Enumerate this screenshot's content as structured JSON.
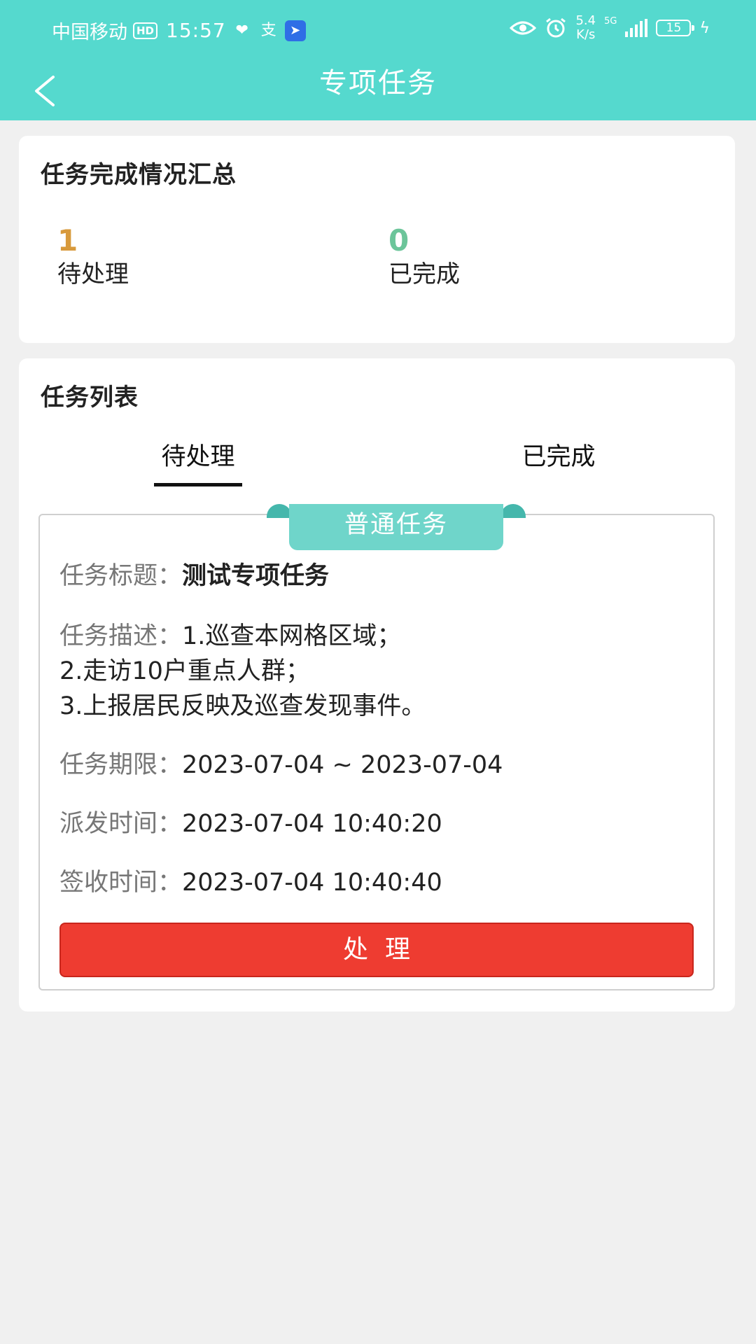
{
  "status_bar": {
    "carrier": "中国移动",
    "hd_badge": "HD",
    "time": "15:57",
    "speed_value": "5.4",
    "speed_unit": "K/s",
    "network": "5G",
    "battery": "15"
  },
  "nav": {
    "title": "专项任务"
  },
  "summary": {
    "title": "任务完成情况汇总",
    "pending_count": "1",
    "pending_label": "待处理",
    "done_count": "0",
    "done_label": "已完成",
    "pending_color": "#d89a3c",
    "done_color": "#6cc59a"
  },
  "task_list": {
    "title": "任务列表",
    "tabs": [
      {
        "label": "待处理",
        "active": true
      },
      {
        "label": "已完成",
        "active": false
      }
    ]
  },
  "task": {
    "type_badge": "普通任务",
    "title_label": "任务标题：",
    "title_value": "测试专项任务",
    "desc_label": "任务描述：",
    "desc_lines": [
      "1.巡查本网格区域；",
      "2.走访10户重点人群；",
      "3.上报居民反映及巡查发现事件。"
    ],
    "period_label": "任务期限：",
    "period_value": "2023-07-04 ~ 2023-07-04",
    "dispatch_label": "派发时间：",
    "dispatch_value": "2023-07-04 10:40:20",
    "sign_label": "签收时间：",
    "sign_value": "2023-07-04 10:40:40",
    "process_button": "处理"
  },
  "colors": {
    "header": "#55d9ce",
    "button": "#ee3c31",
    "ribbon": "#6fd5ca"
  },
  "icons": [
    "back-arrow-icon",
    "heart-icon",
    "alipay-icon",
    "app-icon",
    "eye-icon",
    "alarm-icon",
    "signal-icon",
    "battery-icon",
    "charging-icon"
  ]
}
